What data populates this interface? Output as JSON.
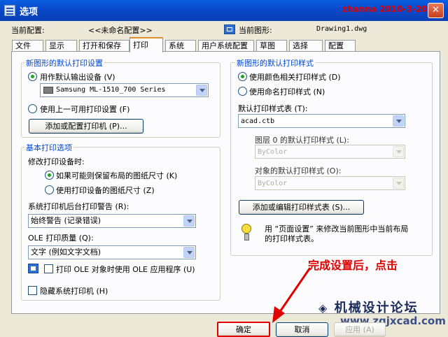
{
  "window": {
    "title": "选项",
    "watermark_text": "zhanna 2010-3-20",
    "close_symbol": "✕"
  },
  "header": {
    "current_profile_label": "当前配置:",
    "current_profile_value": "<<未命名配置>>",
    "current_drawing_label": "当前图形:",
    "current_drawing_value": "Drawing1.dwg"
  },
  "tabs": [
    "文件",
    "显示",
    "打开和保存",
    "打印",
    "系统",
    "用户系统配置",
    "草图",
    "选择",
    "配置"
  ],
  "active_tab": "打印",
  "left": {
    "default_print_group_title": "新图形的默认打印设置",
    "use_default_output_label": "用作默认输出设备 (V)",
    "printer_select_value": "Samsung ML-1510_700 Series",
    "use_last_setting_label": "使用上一可用打印设置 (F)",
    "add_printer_button": "添加或配置打印机 (P)...",
    "basic_options_title": "基本打印选项",
    "change_device_label": "修改打印设备时:",
    "keep_layout_size_label": "如果可能则保留布局的图纸尺寸 (K)",
    "use_device_size_label": "使用打印设备的图纸尺寸 (Z)",
    "background_warning_label": "系统打印机后台打印警告 (R):",
    "background_warning_value": "始终警告  (记录错误)",
    "ole_quality_label": "OLE 打印质量 (Q):",
    "ole_quality_value": "文字  (例如文字文档)",
    "ole_app_label": "打印 OLE 对象时使用 OLE 应用程序 (U)",
    "hide_printers_label": "隐藏系统打印机 (H)"
  },
  "right": {
    "default_style_group_title": "新图形的默认打印样式",
    "use_color_dependent_label": "使用颜色相关打印样式 (D)",
    "use_named_label": "使用命名打印样式 (N)",
    "default_table_label": "默认打印样式表 (T):",
    "default_table_value": "acad.ctb",
    "layer0_label": "图层 0 的默认打印样式 (L):",
    "layer0_value": "ByColor",
    "object_label": "对象的默认打印样式 (O):",
    "object_value": "ByColor",
    "add_edit_button": "添加或编辑打印样式表 (S)...",
    "tip_text_line1": "用 “页面设置” 来修改当前图形中当前布局",
    "tip_text_line2": "的打印样式表。"
  },
  "annotation": {
    "text": "完成设置后，点击",
    "color": "#e00000"
  },
  "site_watermark": {
    "line1": "机械设计论坛",
    "line2": "www.zgjxcad.com"
  },
  "footer": {
    "ok_button": "确定",
    "cancel_button": "取消",
    "apply_button": "应用 (A)"
  }
}
